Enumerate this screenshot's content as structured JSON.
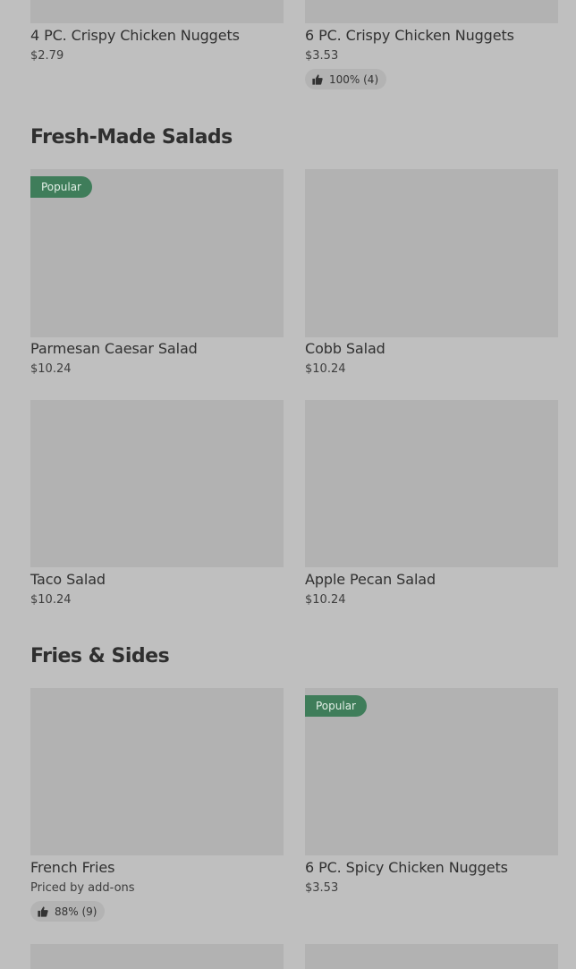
{
  "top_items": [
    {
      "name": "4 PC. Crispy Chicken Nuggets",
      "price": "$2.79"
    },
    {
      "name": "6 PC. Crispy Chicken Nuggets",
      "price": "$3.53",
      "rating": "100% (4)"
    }
  ],
  "sections": [
    {
      "title": "Fresh-Made Salads",
      "items": [
        {
          "name": "Parmesan Caesar Salad",
          "price": "$10.24",
          "badge": "Popular"
        },
        {
          "name": "Cobb Salad",
          "price": "$10.24"
        },
        {
          "name": "Taco Salad",
          "price": "$10.24"
        },
        {
          "name": "Apple Pecan Salad",
          "price": "$10.24"
        }
      ]
    },
    {
      "title": "Fries & Sides",
      "items": [
        {
          "name": "French Fries",
          "price": "Priced by add-ons",
          "rating": "88% (9)"
        },
        {
          "name": "6 PC. Spicy Chicken Nuggets",
          "price": "$3.53",
          "badge": "Popular"
        }
      ]
    }
  ],
  "colors": {
    "page_background": "#bfbfbf",
    "image_placeholder": "#b2b2b2",
    "popular_badge": "#3f7d5a"
  },
  "icons": {
    "rating": "thumbs-up-icon"
  }
}
